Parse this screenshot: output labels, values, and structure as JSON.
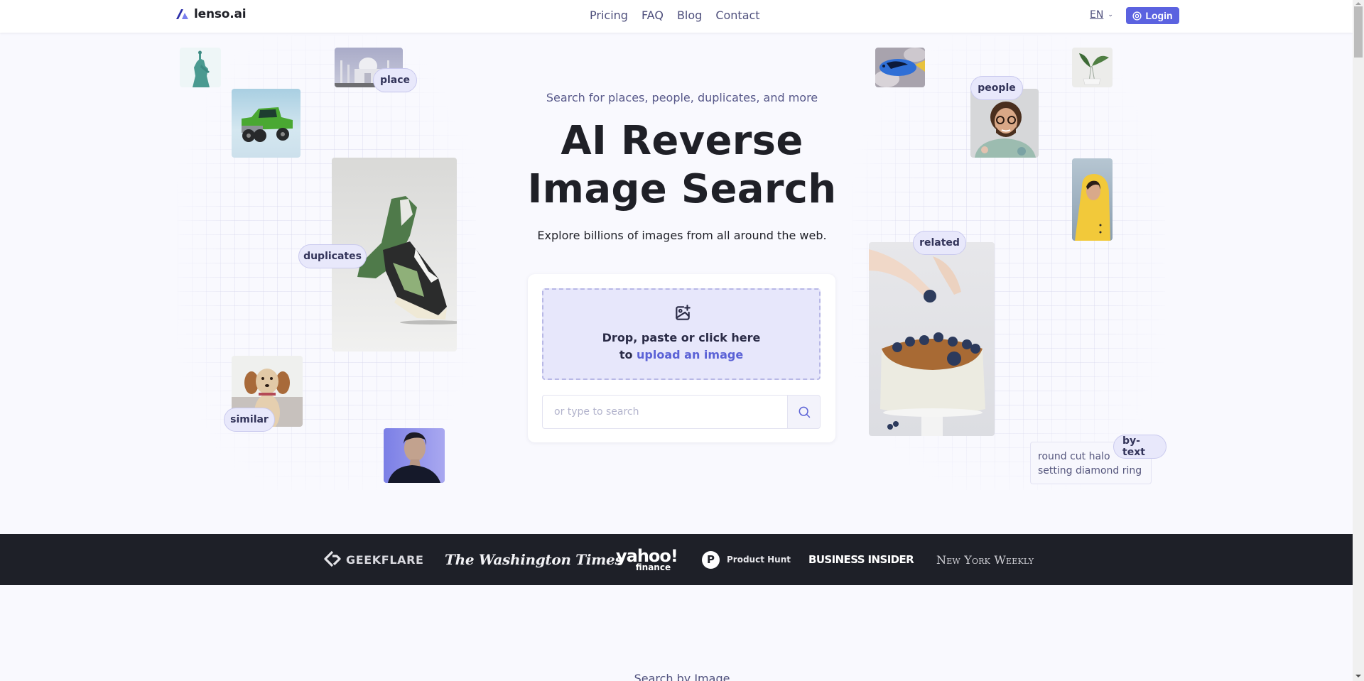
{
  "header": {
    "brand": "lenso.ai",
    "nav": [
      {
        "label": "Pricing"
      },
      {
        "label": "FAQ"
      },
      {
        "label": "Blog"
      },
      {
        "label": "Contact"
      }
    ],
    "language": "EN",
    "login_label": "Login"
  },
  "hero": {
    "kicker": "Search for places, people, duplicates, and more",
    "title_line1": "AI Reverse",
    "title_line2": "Image Search",
    "subtitle": "Explore billions of images from all around the web."
  },
  "upload": {
    "line1": "Drop, paste or click here",
    "line2_prefix": "to ",
    "line2_link": "upload an image",
    "search_placeholder": "or type to search",
    "search_value": ""
  },
  "categories": {
    "place": "place",
    "people": "people",
    "duplicates": "duplicates",
    "related": "related",
    "similar": "similar",
    "by_text": "by-text"
  },
  "text_sample": {
    "line1": "round cut halo",
    "line2": "setting diamond ring"
  },
  "gallery": [
    {
      "subject": "statue-of-liberty"
    },
    {
      "subject": "taj-mahal"
    },
    {
      "subject": "green-truck"
    },
    {
      "subject": "sneakers"
    },
    {
      "subject": "puppy"
    },
    {
      "subject": "woman-portrait-blue"
    },
    {
      "subject": "blue-tang-fish"
    },
    {
      "subject": "curly-haired-man"
    },
    {
      "subject": "plant-in-vase"
    },
    {
      "subject": "woman-yellow-hoodie"
    },
    {
      "subject": "blueberry-cake"
    }
  ],
  "press": {
    "logos": [
      "GEEKFLARE",
      "The Washington Times",
      "yahoo!",
      "finance",
      "Product Hunt",
      "BUSINESS INSIDER",
      "New York Weekly"
    ],
    "ph_letter": "P"
  },
  "next_section_label": "Search by Image",
  "colors": {
    "accent": "#5b62e0",
    "link": "#5b62d6",
    "nav_text": "#4e4f7c",
    "chip_bg": "#e8e8fb",
    "press_bg": "#1e2028",
    "page_bg": "#f9f9fe"
  }
}
